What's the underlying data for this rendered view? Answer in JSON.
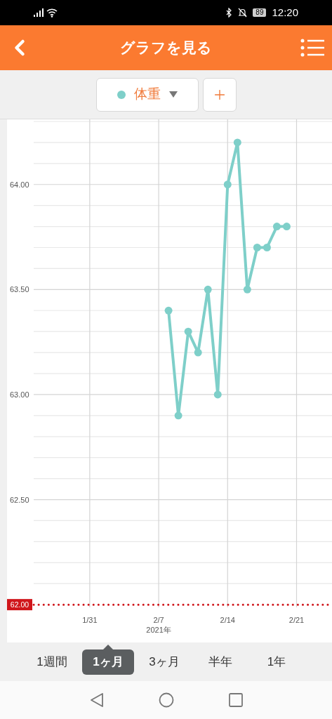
{
  "status_bar": {
    "battery": "89",
    "time": "12:20"
  },
  "header": {
    "title": "グラフを見る"
  },
  "chart": {
    "chart_data": {
      "type": "line",
      "xlabel": "2021年",
      "grid": true,
      "ref_lines": [
        {
          "axis": "y",
          "value": 62,
          "label": "62.00",
          "color": "#d0161b"
        }
      ],
      "categories": [
        null,
        null,
        null,
        null,
        null,
        null,
        null,
        null,
        "1/31",
        null,
        null,
        null,
        null,
        null,
        null,
        "2/7",
        null,
        null,
        null,
        null,
        null,
        null,
        "2/14",
        null,
        null,
        null,
        null,
        null,
        null,
        "2/21",
        null,
        null,
        null
      ],
      "series": [
        {
          "name": "体重",
          "color": "#7ecfc9",
          "marker": "o",
          "values": [
            null,
            null,
            null,
            null,
            null,
            null,
            null,
            null,
            null,
            null,
            null,
            null,
            null,
            null,
            null,
            null,
            63.4,
            62.9,
            63.3,
            63.2,
            63.5,
            63.0,
            64.0,
            64.2,
            63.5,
            63.7,
            63.7,
            63.8,
            63.8,
            null,
            null,
            null,
            null
          ]
        }
      ],
      "ylim": [
        61.82,
        64.31
      ],
      "yticks": [
        {
          "value": 62.5,
          "label": "62.50"
        },
        {
          "value": 63,
          "label": "63.00"
        },
        {
          "value": 63.5,
          "label": "63.50"
        },
        {
          "value": 64,
          "label": "64.00"
        }
      ]
    }
  },
  "periods": [
    {
      "label": "1週間",
      "selected": false
    },
    {
      "label": "1ヶ月",
      "selected": true
    },
    {
      "label": "3ヶ月",
      "selected": false
    },
    {
      "label": "半年",
      "selected": false
    },
    {
      "label": "1年",
      "selected": false
    }
  ]
}
